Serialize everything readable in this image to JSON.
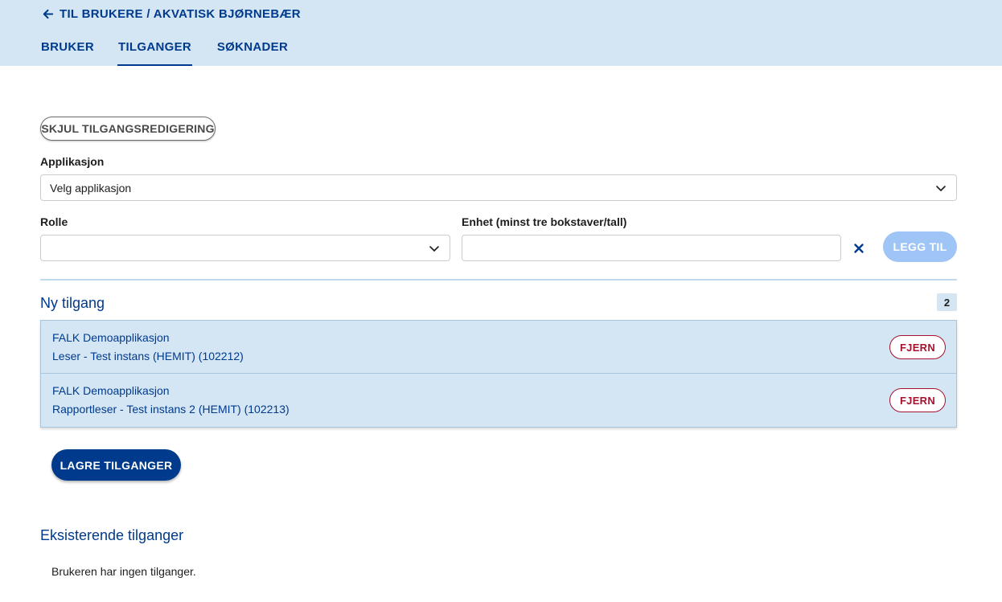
{
  "header": {
    "back_label": "TIL BRUKERE / AKVATISK BJØRNEBÆR",
    "tabs": [
      {
        "label": "BRUKER"
      },
      {
        "label": "TILGANGER"
      },
      {
        "label": "SØKNADER"
      }
    ],
    "active_tab": "TILGANGER"
  },
  "form": {
    "toggle_label": "SKJUL TILGANGSREDIGERING",
    "application_label": "Applikasjon",
    "application_value": "Velg applikasjon",
    "role_label": "Rolle",
    "role_value": "",
    "unit_label": "Enhet (minst tre bokstaver/tall)",
    "unit_value": "",
    "add_label": "LEGG TIL"
  },
  "new_access": {
    "title": "Ny tilgang",
    "count": "2",
    "items": [
      {
        "app": "FALK Demoapplikasjon",
        "role": "Leser - Test instans (HEMIT) (102212)",
        "remove_label": "FJERN"
      },
      {
        "app": "FALK Demoapplikasjon",
        "role": "Rapportleser - Test instans 2 (HEMIT) (102213)",
        "remove_label": "FJERN"
      }
    ]
  },
  "save_label": "LAGRE TILGANGER",
  "existing": {
    "title": "Eksisterende tilganger",
    "empty_text": "Brukeren har ingen tilganger."
  },
  "colors": {
    "header_bg": "#d4e6f4",
    "primary": "#003a8c",
    "danger": "#a4122e",
    "disabled_button": "#9ec5f5"
  },
  "icons": [
    "arrow-left-icon",
    "chevron-down-icon",
    "close-icon"
  ]
}
